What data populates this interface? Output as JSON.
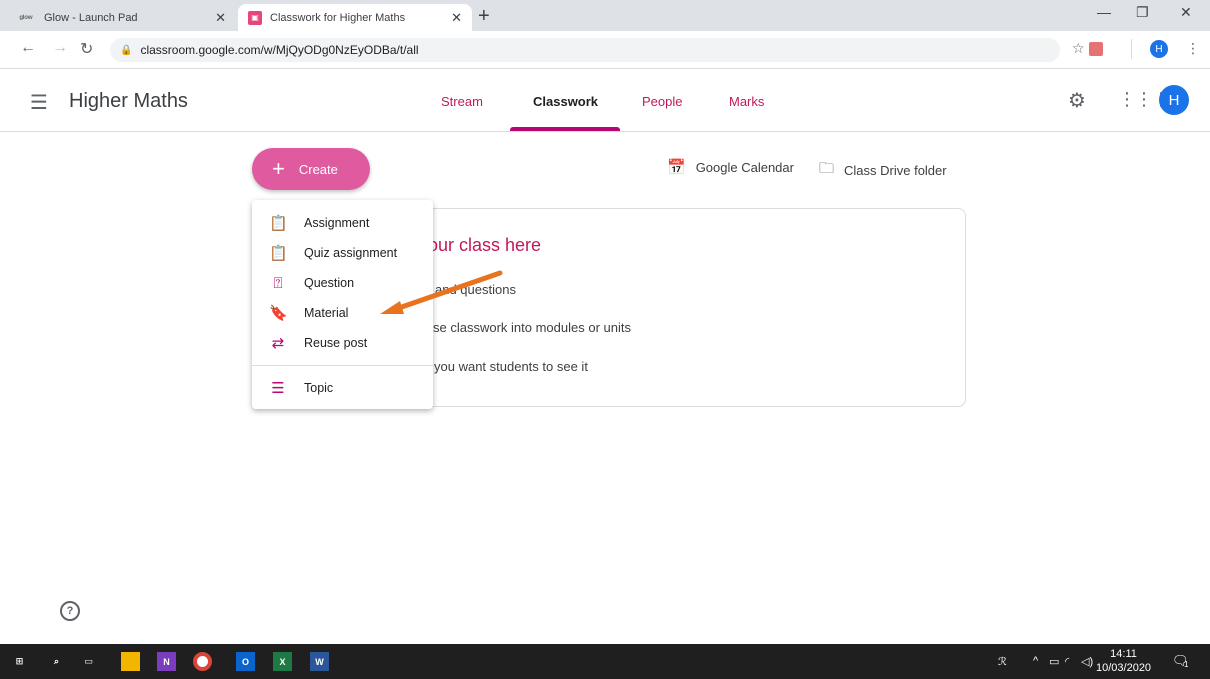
{
  "browser": {
    "tabs": [
      {
        "title": "Glow - Launch Pad",
        "favicon": "glow-icon"
      },
      {
        "title": "Classwork for Higher Maths",
        "favicon": "classroom-icon"
      }
    ],
    "url": "classroom.google.com/w/MjQyODg0NzEyODBa/t/all",
    "profile_initial": "H"
  },
  "header": {
    "class_name": "Higher Maths",
    "tabs": [
      "Stream",
      "Classwork",
      "People",
      "Marks"
    ],
    "active_tab": "Classwork",
    "avatar_initial": "H"
  },
  "main": {
    "create_label": "Create",
    "calendar_label": "Google Calendar",
    "drive_label": "Class Drive folder",
    "card": {
      "title": "our class here",
      "line1": "and questions",
      "line2": "se classwork into modules or units",
      "line3": "you want students to see it"
    }
  },
  "create_menu": {
    "items": [
      "Assignment",
      "Quiz assignment",
      "Question",
      "Material",
      "Reuse post",
      "Topic"
    ]
  },
  "taskbar": {
    "time": "14:11",
    "date": "10/03/2020",
    "notification_count": "1"
  },
  "colors": {
    "accent": "#b80672",
    "create_button": "#e05a9f",
    "arrow": "#e8731f"
  }
}
